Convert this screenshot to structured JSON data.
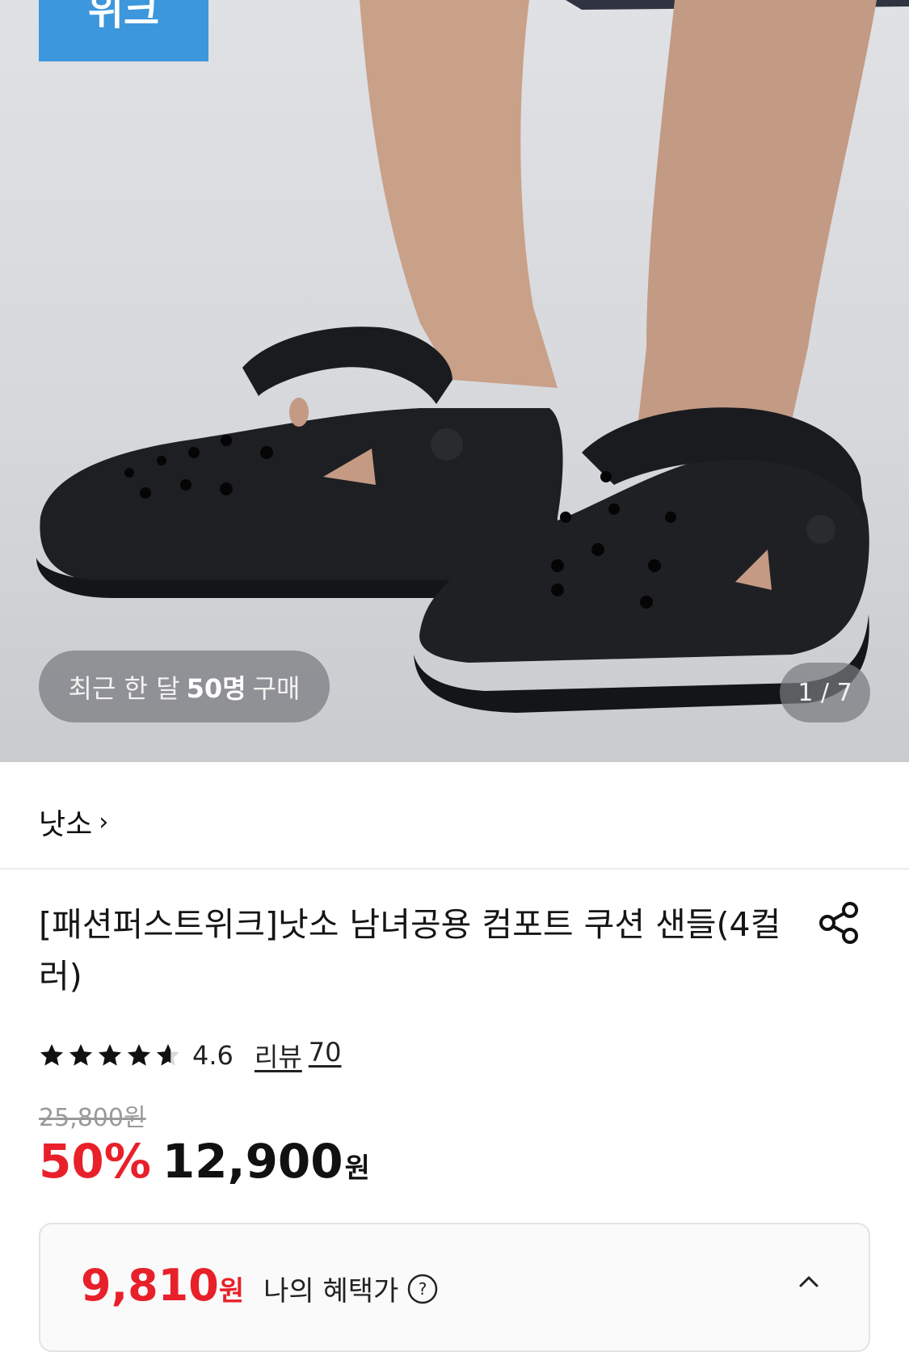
{
  "hero": {
    "week_badge": "위크",
    "buyers_prefix": "최근 한 달",
    "buyers_count": "50명",
    "buyers_suffix": "구매",
    "image_counter": "1 / 7"
  },
  "brand": {
    "name": "낫소",
    "chevron": "›"
  },
  "product": {
    "title": "[패션퍼스트위크]낫소 남녀공용 컴포트 쿠션 샌들(4컬러)",
    "rating": {
      "value": "4.6",
      "stars": 4.6,
      "review_label": "리뷰",
      "review_count": "70"
    },
    "original_price": "25,800원",
    "discount_rate": "50%",
    "sale_price": "12,900",
    "currency": "원"
  },
  "benefit": {
    "price": "9,810",
    "currency": "원",
    "label": "나의 혜택가",
    "help_icon": "question-circle-icon",
    "toggle_icon": "chevron-up-icon"
  },
  "colors": {
    "accent_red": "#e8202a",
    "badge_blue": "#3d97dc"
  }
}
